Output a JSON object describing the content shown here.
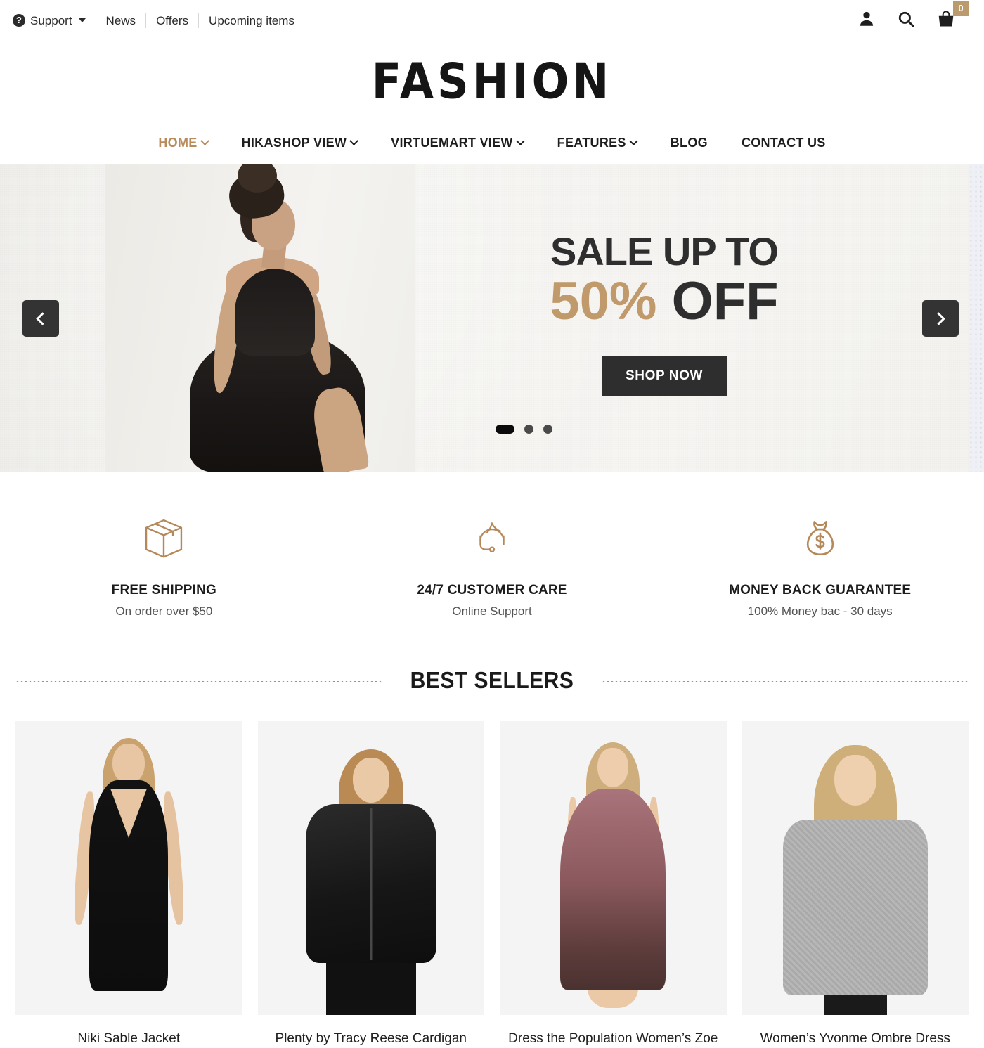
{
  "topbar": {
    "support": {
      "label": "Support",
      "icon": "question-circle-icon"
    },
    "links": [
      {
        "label": "News"
      },
      {
        "label": "Offers"
      },
      {
        "label": "Upcoming items"
      }
    ],
    "icons": {
      "account": "user-icon",
      "search": "search-icon",
      "cart": "shopping-bag-icon"
    },
    "cart_count": "0"
  },
  "logo": {
    "text": "FASHION"
  },
  "nav": {
    "items": [
      {
        "label": "HOME",
        "has_dropdown": true,
        "active": true
      },
      {
        "label": "HIKASHOP VIEW",
        "has_dropdown": true,
        "active": false
      },
      {
        "label": "VIRTUEMART VIEW",
        "has_dropdown": true,
        "active": false
      },
      {
        "label": "FEATURES",
        "has_dropdown": true,
        "active": false
      },
      {
        "label": "BLOG",
        "has_dropdown": false,
        "active": false
      },
      {
        "label": "CONTACT US",
        "has_dropdown": false,
        "active": false
      }
    ]
  },
  "hero": {
    "headline_top": "SALE UP TO",
    "headline_percent": "50%",
    "headline_off": " OFF",
    "cta_label": "SHOP NOW",
    "slides_total": 3,
    "active_slide": 1,
    "prev_label": "Previous slide",
    "next_label": "Next slide"
  },
  "services": [
    {
      "icon": "box-icon",
      "title": "FREE SHIPPING",
      "subtitle": "On order over $50"
    },
    {
      "icon": "headset-icon",
      "title": "24/7 CUSTOMER CARE",
      "subtitle": "Online Support"
    },
    {
      "icon": "money-bag-icon",
      "title": "MONEY BACK GUARANTEE",
      "subtitle": "100% Money bac - 30 days"
    }
  ],
  "best_sellers": {
    "title": "BEST SELLERS",
    "products": [
      {
        "name": "Niki Sable Jacket"
      },
      {
        "name": "Plenty by Tracy Reese Cardigan"
      },
      {
        "name": "Dress the Population Women’s Zoe"
      },
      {
        "name": "Women’s Yvonme Ombre Dress"
      }
    ]
  },
  "colors": {
    "accent_gold": "#b88b5c",
    "icon_gold": "#b5885a",
    "hero_percent": "#c19a6b",
    "dark": "#2e2e2e",
    "badge": "#bb9a6e"
  }
}
